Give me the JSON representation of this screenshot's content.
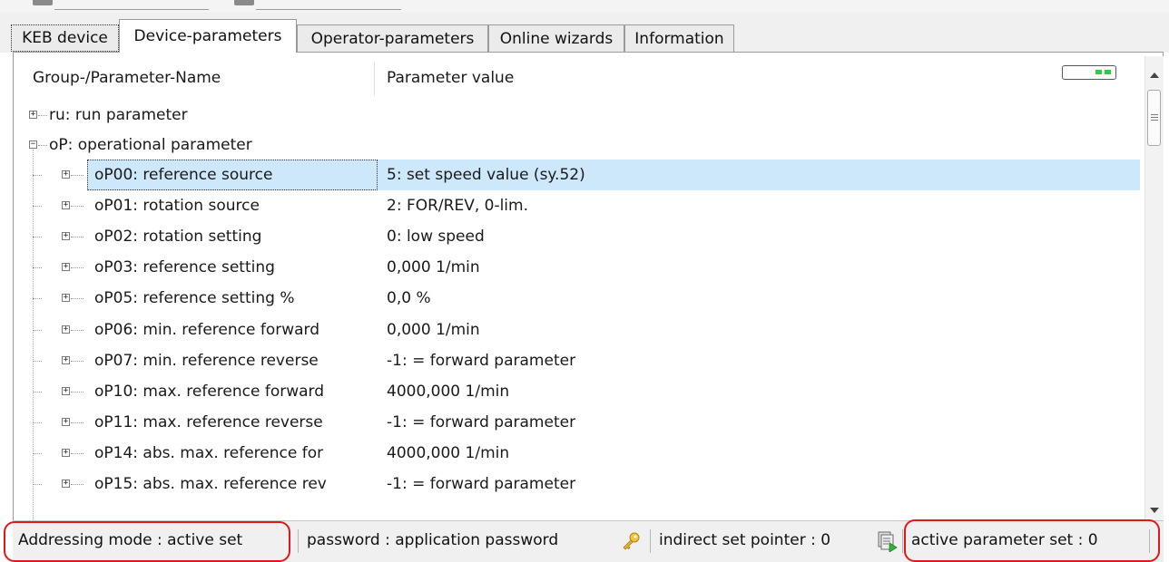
{
  "tabs": [
    {
      "label": "KEB device"
    },
    {
      "label": "Device-parameters"
    },
    {
      "label": "Operator-parameters"
    },
    {
      "label": "Online wizards"
    },
    {
      "label": "Information"
    }
  ],
  "columns": {
    "name": "Group-/Parameter-Name",
    "value": "Parameter value"
  },
  "tree": {
    "groups": [
      {
        "name": "ru: run parameter",
        "expanded": false
      },
      {
        "name": "oP: operational parameter",
        "expanded": true
      }
    ],
    "params": [
      {
        "name": "oP00: reference source",
        "value": "5: set speed value (sy.52)",
        "selected": true
      },
      {
        "name": "oP01: rotation source",
        "value": "2: FOR/REV, 0-lim."
      },
      {
        "name": "oP02: rotation setting",
        "value": "0: low speed"
      },
      {
        "name": "oP03: reference setting",
        "value": "0,000 1/min"
      },
      {
        "name": "oP05: reference setting %",
        "value": "0,0 %"
      },
      {
        "name": "oP06: min. reference forward",
        "value": "0,000 1/min"
      },
      {
        "name": "oP07: min. reference reverse",
        "value": "-1: = forward parameter"
      },
      {
        "name": "oP10: max. reference forward",
        "value": "4000,000 1/min"
      },
      {
        "name": "oP11: max. reference reverse",
        "value": "-1: = forward parameter"
      },
      {
        "name": "oP14: abs. max. reference for",
        "value": "4000,000 1/min"
      },
      {
        "name": "oP15: abs. max. reference rev",
        "value": "-1: = forward parameter"
      }
    ]
  },
  "statusbar": {
    "addressing": "Addressing mode  : active set",
    "password": "password : application password",
    "indirect": "indirect set pointer  : 0",
    "active_set": "active parameter set  : 0"
  },
  "colors": {
    "selection": "#cde8fb",
    "highlight_box": "#e01818",
    "toggle_led": "#2ecc40"
  },
  "icons": [
    "key-icon",
    "parameter-set-icon",
    "expand-icon",
    "collapse-icon",
    "scroll-up-icon",
    "scroll-down-icon"
  ]
}
